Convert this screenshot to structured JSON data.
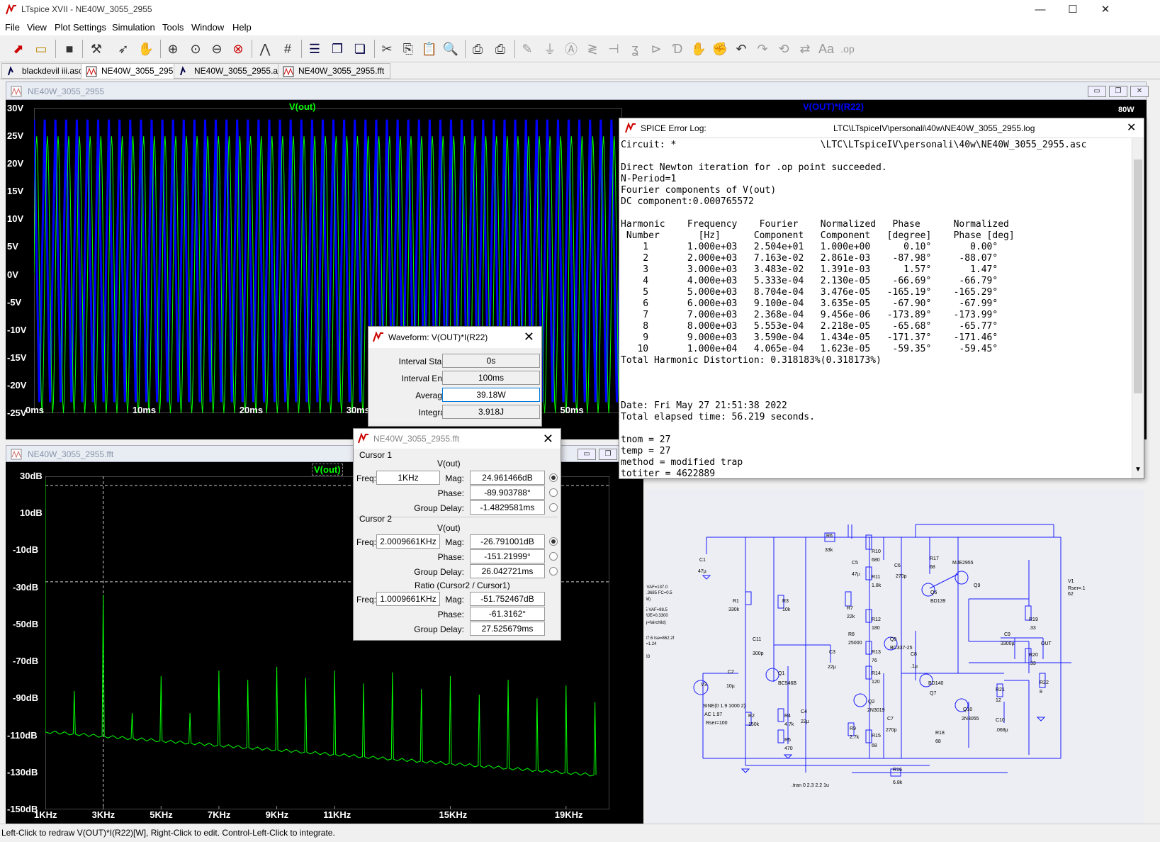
{
  "window": {
    "title": "LTspice XVII - NE40W_3055_2955",
    "minimize": "—",
    "maximize": "☐",
    "close": "✕"
  },
  "menu": [
    "File",
    "View",
    "Plot Settings",
    "Simulation",
    "Tools",
    "Window",
    "Help"
  ],
  "toolbar_icons": [
    "new-schematic-icon",
    "open-icon",
    "save-icon",
    "control-panel-icon",
    "run-icon",
    "halt-icon",
    "zoom-in-icon",
    "zoom-to-fit-icon",
    "zoom-out-icon",
    "zoom-cancel-icon",
    "autorange-icon",
    "grid-icon",
    "tile-horizontal-icon",
    "cascade-icon",
    "tile-vertical-icon",
    "cut-icon",
    "copy-icon",
    "paste-icon",
    "find-icon",
    "print-icon",
    "print-setup-icon",
    "wire-icon",
    "ground-icon",
    "label-icon",
    "resistor-icon",
    "capacitor-icon",
    "inductor-icon",
    "diode-icon",
    "component-icon",
    "move-icon",
    "drag-icon",
    "undo-icon",
    "redo-icon",
    "rotate-icon",
    "mirror-icon",
    "text-icon",
    "spice-directive-icon"
  ],
  "tabs": [
    {
      "label": "blackdevil iii.asc",
      "active": false
    },
    {
      "label": "NE40W_3055_2955",
      "active": true
    },
    {
      "label": "NE40W_3055_2955.asc",
      "active": false
    },
    {
      "label": "NE40W_3055_2955.fft",
      "active": false
    }
  ],
  "plot1": {
    "title": "NE40W_3055_2955",
    "trace1_label": "V(out)",
    "trace2_label": "V(OUT)*I(R22)",
    "right_tick": "80W",
    "yticks": [
      "30V",
      "25V",
      "20V",
      "15V",
      "10V",
      "5V",
      "0V",
      "-5V",
      "-10V",
      "-15V",
      "-20V",
      "-25V"
    ],
    "xticks": [
      "0ms",
      "10ms",
      "20ms",
      "30ms",
      "40ms",
      "50ms"
    ],
    "colors": {
      "trace1": "#00ff00",
      "trace2": "#0000ff",
      "bg": "#000000"
    }
  },
  "plot2": {
    "title": "NE40W_3055_2955.fft",
    "trace_label": "V(out)",
    "yticks": [
      "30dB",
      "10dB",
      "-10dB",
      "-30dB",
      "-50dB",
      "-70dB",
      "-90dB",
      "-110dB",
      "-130dB",
      "-150dB"
    ],
    "xticks": [
      "1KHz",
      "3KHz",
      "5KHz",
      "7KHz",
      "9KHz",
      "11KHz",
      "15KHz",
      "19KHz"
    ]
  },
  "chart_data": [
    {
      "type": "line",
      "title": "",
      "xlabel": "",
      "ylabel": "",
      "xlim": [
        0,
        55
      ],
      "ylim": [
        -25,
        30
      ],
      "x_unit": "ms",
      "series": [
        {
          "name": "V(out)",
          "description_values": {
            "amplitude_V": 25,
            "frequency_Hz": 1000
          }
        },
        {
          "name": "V(OUT)*I(R22)",
          "description_values": {
            "peak_W": 80
          }
        }
      ]
    },
    {
      "type": "line",
      "title": "",
      "xlabel": "",
      "ylabel": "",
      "x_categories": [
        "1KHz",
        "3KHz",
        "5KHz",
        "7KHz",
        "9KHz",
        "11KHz",
        "15KHz",
        "19KHz"
      ],
      "ylim": [
        -150,
        30
      ],
      "series": [
        {
          "name": "V(out)",
          "harmonics_kHz": [
            1,
            2,
            3,
            4,
            5,
            6,
            7,
            8,
            9,
            10,
            11,
            12,
            13,
            14,
            15,
            16,
            17,
            18,
            19,
            20
          ],
          "peaks_dB": [
            28,
            -86,
            -34,
            -98,
            -78,
            -98,
            -75,
            -80,
            -73,
            -79,
            -75,
            -82,
            -76,
            -85,
            -78,
            -88,
            -80,
            -90,
            -83,
            -92
          ],
          "noise_floor_dB": [
            -108,
            -112,
            -116,
            -120,
            -124,
            -128,
            -132
          ]
        }
      ]
    }
  ],
  "error_log": {
    "title": "SPICE Error Log:",
    "path": "LTC\\LTspiceIV\\personali\\40w\\NE40W_3055_2955.log",
    "lines": [
      "Circuit: *                          \\LTC\\LTspiceIV\\personali\\40w\\NE40W_3055_2955.asc",
      "",
      "Direct Newton iteration for .op point succeeded.",
      "N-Period=1",
      "Fourier components of V(out)",
      "DC component:0.000765572",
      "",
      "Harmonic    Frequency    Fourier    Normalized   Phase      Normalized",
      " Number       [Hz]      Component   Component   [degree]    Phase [deg]",
      "    1       1.000e+03   2.504e+01   1.000e+00      0.10°       0.00°",
      "    2       2.000e+03   7.163e-02   2.861e-03    -87.98°     -88.07°",
      "    3       3.000e+03   3.483e-02   1.391e-03      1.57°       1.47°",
      "    4       4.000e+03   5.333e-04   2.130e-05    -66.69°     -66.79°",
      "    5       5.000e+03   8.704e-04   3.476e-05   -165.19°    -165.29°",
      "    6       6.000e+03   9.100e-04   3.635e-05    -67.90°     -67.99°",
      "    7       7.000e+03   2.368e-04   9.456e-06   -173.89°    -173.99°",
      "    8       8.000e+03   5.553e-04   2.218e-05    -65.68°     -65.77°",
      "    9       9.000e+03   3.590e-04   1.434e-05   -171.37°    -171.46°",
      "   10       1.000e+04   4.065e-04   1.623e-05    -59.35°     -59.45°",
      "Total Harmonic Distortion: 0.318183%(0.318173%)",
      "",
      "",
      "",
      "Date: Fri May 27 21:51:38 2022",
      "Total elapsed time: 56.219 seconds.",
      "",
      "tnom = 27",
      "temp = 27",
      "method = modified trap",
      "totiter = 4622889"
    ]
  },
  "waveform_dialog": {
    "title": "Waveform: V(OUT)*I(R22)",
    "interval_start_label": "Interval Start:",
    "interval_start": "0s",
    "interval_end_label": "Interval End:",
    "interval_end": "100ms",
    "average_label": "Average:",
    "average": "39.18W",
    "integral_label": "Integral:",
    "integral": "3.918J"
  },
  "cursor_dialog": {
    "title": "NE40W_3055_2955.fft",
    "cursor1_label": "Cursor 1",
    "cursor1_trace": "V(out)",
    "cursor1_freq": "1KHz",
    "cursor1_mag": "24.961466dB",
    "cursor1_phase": "-89.903788°",
    "cursor1_gd": "-1.4829581ms",
    "cursor2_label": "Cursor 2",
    "cursor2_trace": "V(out)",
    "cursor2_freq": "2.0009661KHz",
    "cursor2_mag": "-26.791001dB",
    "cursor2_phase": "-151.21999°",
    "cursor2_gd": "26.042721ms",
    "ratio_label": "Ratio (Cursor2 / Cursor1)",
    "ratio_freq": "1.0009661KHz",
    "ratio_mag": "-51.752467dB",
    "ratio_phase": "-61.3162°",
    "ratio_gd": "27.525679ms",
    "freq_label": "Freq:",
    "mag_label": "Mag:",
    "phase_label": "Phase:",
    "gd_label": "Group Delay:"
  },
  "schematic": {
    "components": [
      "R6",
      "33k",
      "R10",
      "680",
      "C5",
      "47µ",
      "C6",
      "270p",
      "R17",
      "68",
      "MJE2955",
      "Q9",
      "C1",
      "47µ",
      "R11",
      "1.8k",
      "Q6",
      "BD139",
      "V1",
      "Rser=.1",
      "62",
      "R1",
      "330k",
      "R3",
      "10k",
      "R7",
      "22k",
      "R12",
      "180",
      "R19",
      ".33",
      "R8",
      "25000",
      "Q5",
      "BC337-25",
      "C9",
      "3300µ",
      "OUT",
      "C11",
      "300p",
      "R13",
      "76",
      "C8",
      ".1µ",
      "R20",
      ".33",
      "C3",
      "22µ",
      "C2",
      "10µ",
      "Q1",
      "BC546B",
      "R14",
      "120",
      "BD140",
      "Q7",
      "R22",
      "8",
      "V3",
      "R21",
      "12",
      "SINE(0 1.9 1000 2)",
      "AC 1.97",
      "Rser=100",
      "Q2",
      "2N3019",
      "Q10",
      "2N3055",
      "R2",
      "150k",
      "R4",
      "4.7k",
      "C4",
      "22µ",
      "C7",
      "270p",
      "R9",
      "2.7k",
      "R15",
      "68",
      "R18",
      "68",
      "C10",
      ".068µ",
      "R5",
      "470",
      "R16",
      "6.8k",
      "1 khz",
      ".tran 0 2.3 2.2 1u"
    ],
    "model_text": [
      "o NC=1.38 VAF=137.0",
      "211 MJE=0.3685 FC=0.5",
      "mfg=fairchild)",
      "11 NC=1.45 VAF=98.5",
      "=0.67412 MJE=0.3300",
      "ating=3 mfg=fairchild)",
      "=100 Bf=137.6 Ise=862.2f",
      "=273.5f Nc=1.24",
      "=.75 Fc=.5",
      "21n Itf=71.33"
    ]
  },
  "status_bar": "Left-Click to redraw V(OUT)*I(R22)[W],  Right-Click to edit. Control-Left-Click to integrate."
}
